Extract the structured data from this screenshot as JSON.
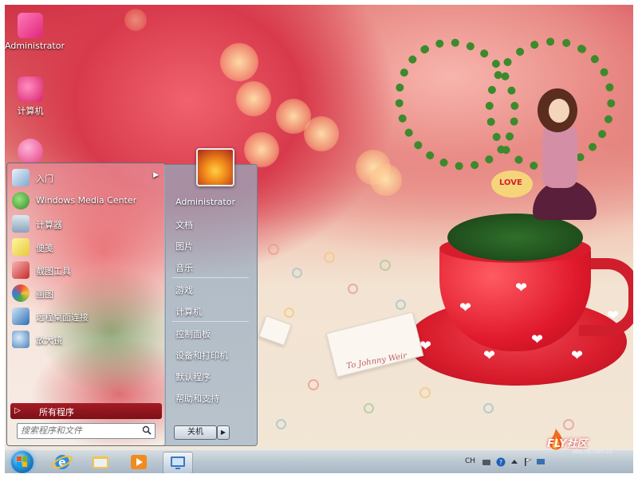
{
  "desktop": {
    "icons": [
      {
        "label": "Administrator",
        "icon": "user-folder-icon"
      },
      {
        "label": "计算机",
        "icon": "computer-icon"
      },
      {
        "label": "",
        "icon": "network-globe-icon"
      }
    ],
    "wallpaper_note": "To Johnny Weir",
    "heart_sign": "LOVE"
  },
  "start_menu": {
    "left_items": [
      {
        "label": "入门",
        "icon": "getting-started-icon",
        "submenu": true
      },
      {
        "label": "Windows Media Center",
        "icon": "media-center-icon"
      },
      {
        "label": "计算器",
        "icon": "calculator-icon"
      },
      {
        "label": "便笺",
        "icon": "sticky-notes-icon"
      },
      {
        "label": "截图工具",
        "icon": "snipping-tool-icon"
      },
      {
        "label": "画图",
        "icon": "paint-icon"
      },
      {
        "label": "远程桌面连接",
        "icon": "remote-desktop-icon"
      },
      {
        "label": "放大镜",
        "icon": "magnifier-icon"
      }
    ],
    "all_programs": "所有程序",
    "search_placeholder": "搜索程序和文件",
    "right_links": [
      {
        "label": "Administrator"
      },
      {
        "label": "文档"
      },
      {
        "label": "图片"
      },
      {
        "label": "音乐"
      },
      {
        "label": "游戏"
      },
      {
        "label": "计算机"
      },
      {
        "label": "控制面板"
      },
      {
        "label": "设备和打印机"
      },
      {
        "label": "默认程序"
      },
      {
        "label": "帮助和支持"
      }
    ],
    "shutdown_label": "关机"
  },
  "taskbar": {
    "pinned": [
      {
        "icon": "internet-explorer-icon"
      },
      {
        "icon": "file-explorer-icon"
      },
      {
        "icon": "media-player-icon"
      },
      {
        "icon": "remote-desktop-icon",
        "active": true
      }
    ],
    "tray": {
      "language": "CH"
    }
  },
  "watermark": {
    "brand": "FLY社区",
    "sub": "bbs.fly.com.cn"
  },
  "colors": {
    "accent": "#a41c25",
    "taskbar": "#b2c2d0"
  }
}
